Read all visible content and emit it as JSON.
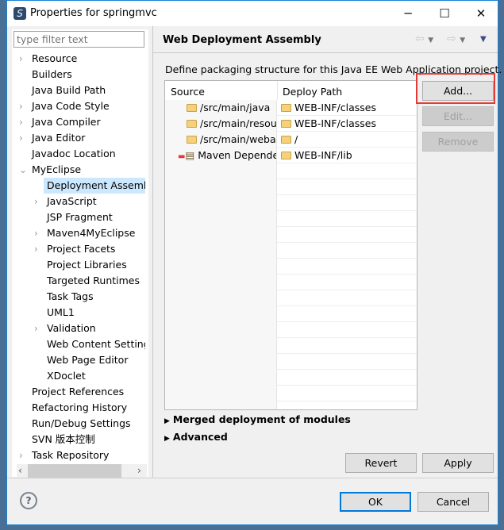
{
  "window": {
    "title": "Properties for springmvc",
    "min": "─",
    "max": "☐",
    "close": "✕"
  },
  "filter": {
    "placeholder": "type filter text"
  },
  "tree": [
    {
      "label": "Resource",
      "level": 0,
      "expandable": true
    },
    {
      "label": "Builders",
      "level": 0
    },
    {
      "label": "Java Build Path",
      "level": 0
    },
    {
      "label": "Java Code Style",
      "level": 0,
      "expandable": true
    },
    {
      "label": "Java Compiler",
      "level": 0,
      "expandable": true
    },
    {
      "label": "Java Editor",
      "level": 0,
      "expandable": true
    },
    {
      "label": "Javadoc Location",
      "level": 0
    },
    {
      "label": "MyEclipse",
      "level": 0,
      "expanded": true
    },
    {
      "label": "Deployment Assembl",
      "level": 1,
      "selected": true
    },
    {
      "label": "JavaScript",
      "level": 1,
      "expandable": true
    },
    {
      "label": "JSP Fragment",
      "level": 1
    },
    {
      "label": "Maven4MyEclipse",
      "level": 1,
      "expandable": true
    },
    {
      "label": "Project Facets",
      "level": 1,
      "expandable": true
    },
    {
      "label": "Project Libraries",
      "level": 1
    },
    {
      "label": "Targeted Runtimes",
      "level": 1
    },
    {
      "label": "Task Tags",
      "level": 1
    },
    {
      "label": "UML1",
      "level": 1
    },
    {
      "label": "Validation",
      "level": 1,
      "expandable": true
    },
    {
      "label": "Web Content Settings",
      "level": 1
    },
    {
      "label": "Web Page Editor",
      "level": 1
    },
    {
      "label": "XDoclet",
      "level": 1
    },
    {
      "label": "Project References",
      "level": 0
    },
    {
      "label": "Refactoring History",
      "level": 0
    },
    {
      "label": "Run/Debug Settings",
      "level": 0
    },
    {
      "label": "SVN 版本控制",
      "level": 0
    },
    {
      "label": "Task Repository",
      "level": 0,
      "expandable": true
    }
  ],
  "page": {
    "title": "Web Deployment Assembly",
    "description": "Define packaging structure for this Java EE Web Application project.",
    "columns": [
      "Source",
      "Deploy Path"
    ],
    "rows": [
      {
        "source": "/src/main/java",
        "path": "WEB-INF/classes",
        "icon": "folder"
      },
      {
        "source": "/src/main/resources",
        "path": "WEB-INF/classes",
        "icon": "folder"
      },
      {
        "source": "/src/main/webapp",
        "path": "/",
        "icon": "folder"
      },
      {
        "source": "Maven Dependencies",
        "path": "WEB-INF/lib",
        "icon": "library"
      }
    ],
    "add": "Add...",
    "edit": "Edit...",
    "remove": "Remove",
    "merged": "Merged deployment of modules",
    "advanced": "Advanced",
    "revert": "Revert",
    "apply": "Apply"
  },
  "footer": {
    "help": "?",
    "ok": "OK",
    "cancel": "Cancel"
  },
  "colors": {
    "highlight": "#e53935",
    "selection": "#cce8ff",
    "default_button": "#0078d7"
  }
}
